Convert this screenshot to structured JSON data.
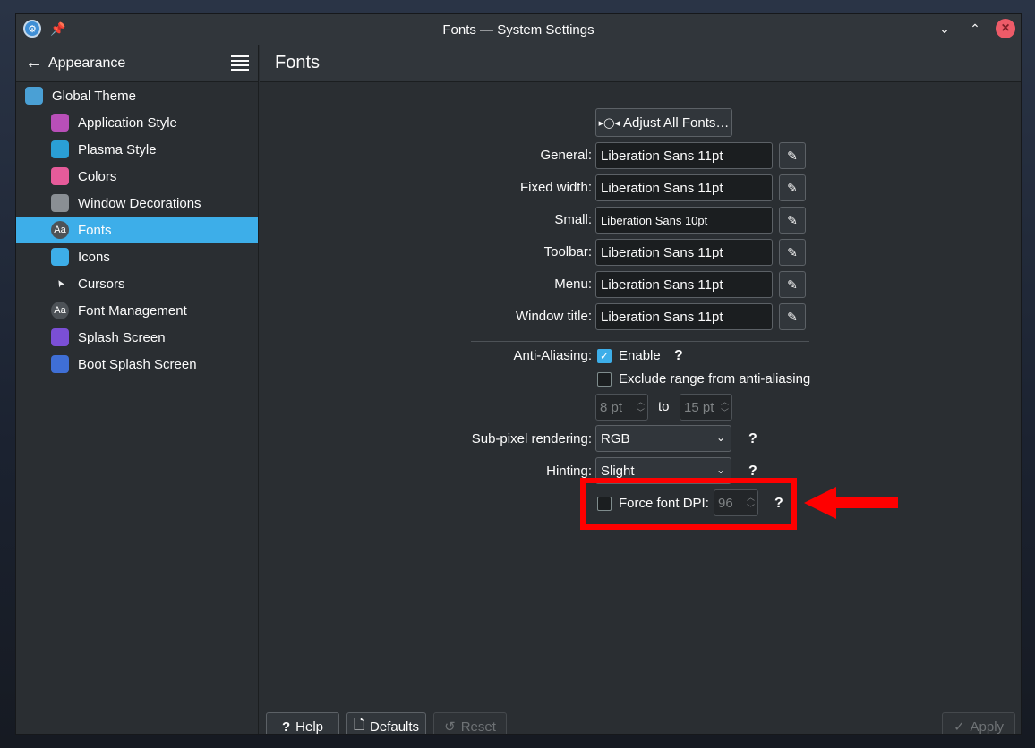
{
  "window": {
    "title": "Fonts — System Settings"
  },
  "sidebar": {
    "header": "Appearance",
    "items": [
      {
        "label": "Global Theme",
        "icon": "global-theme-icon",
        "level": "top",
        "color": "#4aa0d5"
      },
      {
        "label": "Application Style",
        "icon": "application-style-icon",
        "level": "child",
        "color": "#b84fb8"
      },
      {
        "label": "Plasma Style",
        "icon": "plasma-style-icon",
        "level": "child",
        "color": "#2a9fd6"
      },
      {
        "label": "Colors",
        "icon": "colors-icon",
        "level": "child",
        "color": "#e65b9a"
      },
      {
        "label": "Window Decorations",
        "icon": "window-decorations-icon",
        "level": "child",
        "color": "#8a8f94"
      },
      {
        "label": "Fonts",
        "icon": "fonts-icon",
        "level": "child",
        "active": true,
        "color": "#4d5257"
      },
      {
        "label": "Icons",
        "icon": "icons-icon",
        "level": "child",
        "color": "#3daee9"
      },
      {
        "label": "Cursors",
        "icon": "cursors-icon",
        "level": "child",
        "color": "#eff0f1"
      },
      {
        "label": "Font Management",
        "icon": "font-management-icon",
        "level": "child",
        "color": "#4d5257"
      },
      {
        "label": "Splash Screen",
        "icon": "splash-screen-icon",
        "level": "child",
        "color": "#7b4fd6"
      },
      {
        "label": "Boot Splash Screen",
        "icon": "boot-splash-screen-icon",
        "level": "child",
        "color": "#3f6fd6"
      }
    ]
  },
  "main": {
    "title": "Fonts",
    "adjust_all": "Adjust All Fonts…",
    "fonts": [
      {
        "label": "General:",
        "value": "Liberation Sans 11pt"
      },
      {
        "label": "Fixed width:",
        "value": "Liberation Sans 11pt"
      },
      {
        "label": "Small:",
        "value": "Liberation Sans 10pt"
      },
      {
        "label": "Toolbar:",
        "value": "Liberation Sans 11pt"
      },
      {
        "label": "Menu:",
        "value": "Liberation Sans 11pt"
      },
      {
        "label": "Window title:",
        "value": "Liberation Sans 11pt"
      }
    ],
    "antialiasing": {
      "label": "Anti-Aliasing:",
      "enable_label": "Enable",
      "enable_checked": true,
      "exclude_label": "Exclude range from anti-aliasing",
      "exclude_checked": false,
      "range_from": "8 pt",
      "range_to_label": "to",
      "range_to": "15 pt"
    },
    "subpixel": {
      "label": "Sub-pixel rendering:",
      "value": "RGB"
    },
    "hinting": {
      "label": "Hinting:",
      "value": "Slight"
    },
    "force_dpi": {
      "label": "Force font DPI:",
      "checked": false,
      "value": "96"
    },
    "help_glyph": "?"
  },
  "footer": {
    "help": "Help",
    "defaults": "Defaults",
    "reset": "Reset",
    "apply": "Apply"
  },
  "annotation": {
    "color": "#ff0000"
  }
}
